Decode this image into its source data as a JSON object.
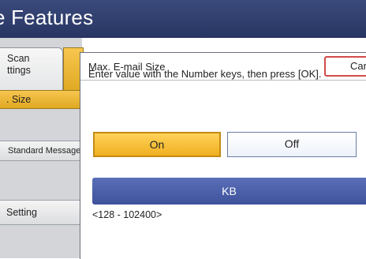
{
  "header": {
    "title": "e Features"
  },
  "sidebar": {
    "tab_scan_line1": "Scan",
    "tab_scan_line2": "ttings",
    "items": [
      {
        "label": ". Size"
      },
      {
        "label": "Standard Message"
      },
      {
        "label": "Setting"
      }
    ]
  },
  "dialog": {
    "title": "Max. E-mail Size",
    "cancel_label": "Car",
    "instruction": "Enter value with the Number keys, then press [OK].",
    "on_label": "On",
    "off_label": "Off",
    "unit_label": "KB",
    "range_text": "<128 - 102400>",
    "selected": "On"
  },
  "colors": {
    "header_bg": "#2f3c6b",
    "selected_gold": "#f0b020",
    "kb_bar": "#4a5ea8",
    "cancel_border": "#d24b4b"
  }
}
